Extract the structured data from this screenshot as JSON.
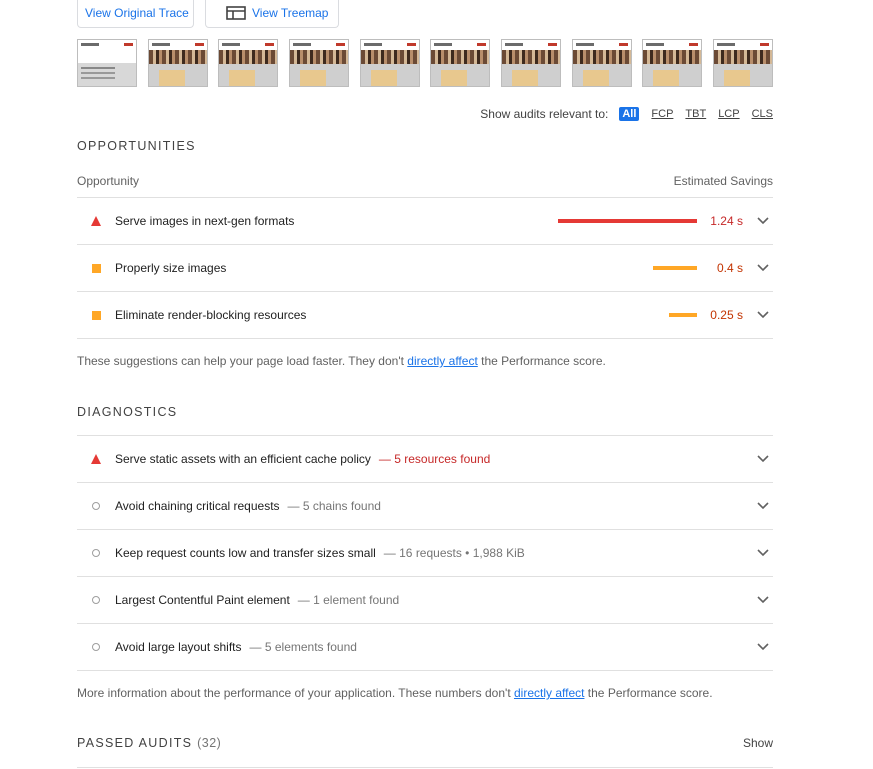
{
  "toolbar": {
    "view_trace": "View Original Trace",
    "view_treemap": "View Treemap"
  },
  "filmstrip": {
    "frames": [
      "frame-1",
      "frame-2",
      "frame-3",
      "frame-4",
      "frame-5",
      "frame-6",
      "frame-7",
      "frame-8",
      "frame-9",
      "frame-10"
    ]
  },
  "filter": {
    "label": "Show audits relevant to:",
    "chips": [
      "All",
      "FCP",
      "TBT",
      "LCP",
      "CLS"
    ],
    "active": "All"
  },
  "opportunities": {
    "title": "OPPORTUNITIES",
    "col_left": "Opportunity",
    "col_right": "Estimated Savings",
    "items": [
      {
        "title": "Serve images in next-gen formats",
        "savings": "1.24 s",
        "severity": "fail",
        "icon": "red-triangle-icon",
        "bar_fraction": 1.0,
        "color": "#e53935"
      },
      {
        "title": "Properly size images",
        "savings": "0.4 s",
        "severity": "average",
        "icon": "orange-square-icon",
        "bar_fraction": 0.32,
        "color": "#ffa726"
      },
      {
        "title": "Eliminate render-blocking resources",
        "savings": "0.25 s",
        "severity": "average",
        "icon": "orange-square-icon",
        "bar_fraction": 0.2,
        "color": "#ffa726"
      }
    ],
    "note_before": "These suggestions can help your page load faster. They don't ",
    "note_link": "directly affect",
    "note_after": " the Performance score."
  },
  "diagnostics": {
    "title": "DIAGNOSTICS",
    "items": [
      {
        "title": "Serve static assets with an efficient cache policy",
        "detail": "— 5 resources found",
        "severity": "fail",
        "icon": "red-triangle-icon"
      },
      {
        "title": "Avoid chaining critical requests",
        "detail": "— 5 chains found",
        "severity": "info",
        "icon": "gray-circle-icon"
      },
      {
        "title": "Keep request counts low and transfer sizes small",
        "detail": "— 16 requests • 1,988 KiB",
        "severity": "info",
        "icon": "gray-circle-icon"
      },
      {
        "title": "Largest Contentful Paint element",
        "detail": "— 1 element found",
        "severity": "info",
        "icon": "gray-circle-icon"
      },
      {
        "title": "Avoid large layout shifts",
        "detail": "— 5 elements found",
        "severity": "info",
        "icon": "gray-circle-icon"
      }
    ],
    "note_before": "More information about the performance of your application. These numbers don't ",
    "note_link": "directly affect",
    "note_after": " the Performance score."
  },
  "passed": {
    "title": "PASSED AUDITS",
    "count": "(32)",
    "toggle": "Show"
  },
  "colors": {
    "accent": "#1a73e8",
    "fail": "#e53935",
    "average": "#ffa726",
    "info": "#9e9e9e"
  }
}
